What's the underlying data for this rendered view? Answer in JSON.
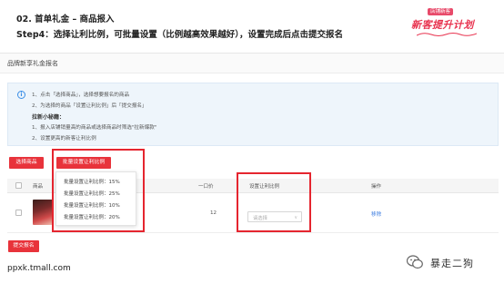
{
  "slide": {
    "title": "02. 首单礼金 – 商品报入",
    "step": "Step4：选择让利比例，可批量设置（比例越高效果越好），设置完成后点击提交报名"
  },
  "logo": {
    "tag": "店铺新客",
    "main": "新客提升计划"
  },
  "panel": {
    "title": "品牌新享礼金报名"
  },
  "notice": {
    "line1": "1、点击「选择商品」，选择想要报名的商品",
    "line2": "2、为选择的商品「设置让利比例」后「提交报名」",
    "heading": "拉新小秘籍：",
    "tip1": "1、报入店铺销量高的商品或选择商品时筛选\"拉新爆款\"",
    "tip2": "2、设置更高的新客让利比例"
  },
  "buttons": {
    "select_goods": "选择商品",
    "batch_set": "批量设置让利比例",
    "submit": "提交报名"
  },
  "table": {
    "headers": {
      "goods": "商品",
      "price": "一口价",
      "ratio": "设置让利比例",
      "action": "操作"
    },
    "row": {
      "price": "12",
      "ratio_placeholder": "请选择",
      "action": "移除"
    }
  },
  "dropdown": {
    "items": [
      "批量设置让利比例：15%",
      "批量设置让利比例：25%",
      "批量设置让利比例：10%",
      "批量设置让利比例：20%"
    ]
  },
  "footer": {
    "url": "ppxk.tmall.com",
    "wechat_name": "暴走二狗"
  },
  "colors": {
    "accent_red": "#e8333b",
    "highlight_box": "#e5252f",
    "link_blue": "#3a7be0",
    "notice_bg": "#eef5fb"
  },
  "icons": [
    "info-icon",
    "checkbox-icon",
    "chevron-down-icon",
    "wechat-icon"
  ]
}
